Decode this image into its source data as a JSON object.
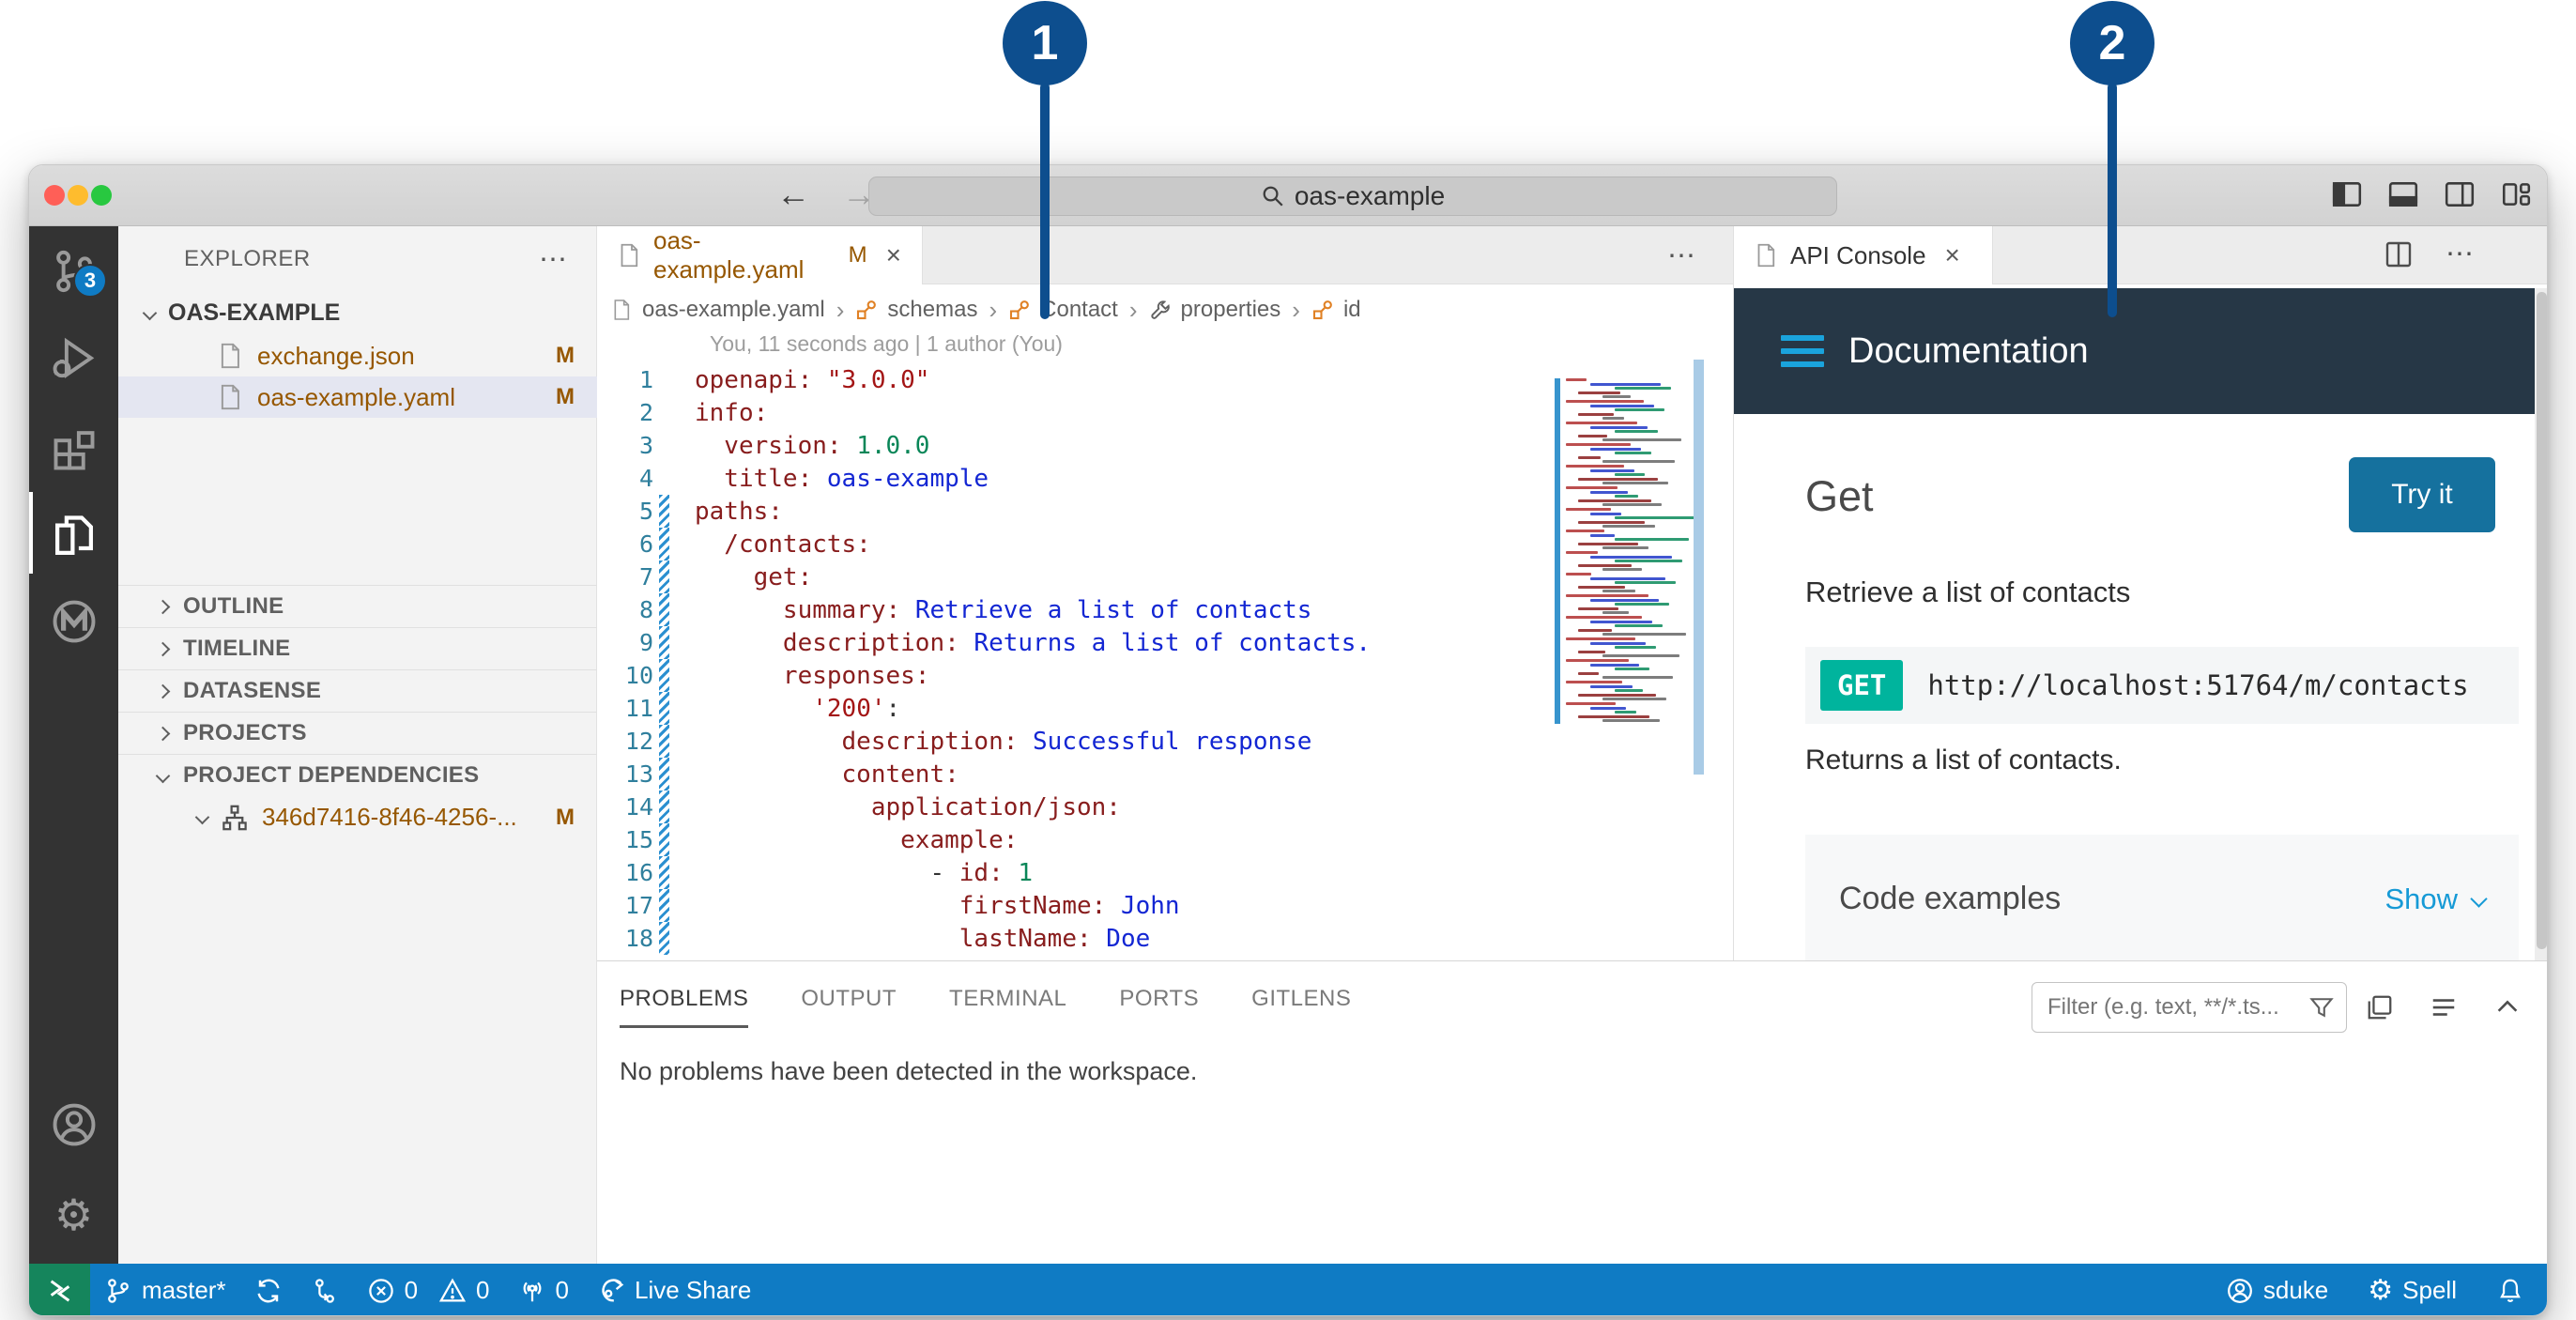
{
  "callouts": {
    "one": "1",
    "two": "2"
  },
  "titlebar": {
    "search_value": "oas-example"
  },
  "activity_bar": {
    "scm_badge": "3"
  },
  "explorer": {
    "title": "EXPLORER",
    "project": "OAS-EXAMPLE",
    "files": [
      {
        "name": "exchange.json",
        "badge": "M",
        "selected": false
      },
      {
        "name": "oas-example.yaml",
        "badge": "M",
        "selected": true
      }
    ],
    "sections": [
      {
        "label": "OUTLINE",
        "expanded": false
      },
      {
        "label": "TIMELINE",
        "expanded": false
      },
      {
        "label": "DATASENSE",
        "expanded": false
      },
      {
        "label": "PROJECTS",
        "expanded": false
      },
      {
        "label": "PROJECT DEPENDENCIES",
        "expanded": true
      }
    ],
    "dependency": {
      "name": "346d7416-8f46-4256-...",
      "badge": "M"
    }
  },
  "editor": {
    "tab": {
      "title": "oas-example.yaml",
      "badge": "M",
      "close": "×"
    },
    "breadcrumb": [
      {
        "label": "oas-example.yaml",
        "icon": "file"
      },
      {
        "label": "schemas",
        "icon": "class"
      },
      {
        "label": "Contact",
        "icon": "class"
      },
      {
        "label": "properties",
        "icon": "wrench"
      },
      {
        "label": "id",
        "icon": "class"
      }
    ],
    "blame": "You, 11 seconds ago | 1 author (You)",
    "lines": [
      {
        "n": "1",
        "mod": false,
        "t": [
          [
            "openapi: ",
            "k"
          ],
          [
            "\"3.0.0\"",
            "s"
          ]
        ]
      },
      {
        "n": "2",
        "mod": false,
        "t": [
          [
            "info:",
            "k"
          ]
        ]
      },
      {
        "n": "3",
        "mod": false,
        "t": [
          [
            "  version: ",
            "k"
          ],
          [
            "1.0.0",
            "n"
          ]
        ]
      },
      {
        "n": "4",
        "mod": false,
        "t": [
          [
            "  title: ",
            "k"
          ],
          [
            "oas-example",
            "v"
          ]
        ]
      },
      {
        "n": "5",
        "mod": true,
        "t": [
          [
            "paths:",
            "k"
          ]
        ]
      },
      {
        "n": "6",
        "mod": true,
        "t": [
          [
            "  /contacts:",
            "k"
          ]
        ]
      },
      {
        "n": "7",
        "mod": true,
        "t": [
          [
            "    get:",
            "k"
          ]
        ]
      },
      {
        "n": "8",
        "mod": true,
        "t": [
          [
            "      summary: ",
            "k"
          ],
          [
            "Retrieve a list of contacts",
            "v"
          ]
        ]
      },
      {
        "n": "9",
        "mod": true,
        "t": [
          [
            "      description: ",
            "k"
          ],
          [
            "Returns a list of contacts.",
            "v"
          ]
        ]
      },
      {
        "n": "10",
        "mod": true,
        "t": [
          [
            "      responses:",
            "k"
          ]
        ]
      },
      {
        "n": "11",
        "mod": true,
        "t": [
          [
            "        ",
            "d"
          ],
          [
            "'200'",
            "s"
          ],
          [
            ":",
            "d"
          ]
        ]
      },
      {
        "n": "12",
        "mod": true,
        "t": [
          [
            "          description: ",
            "k"
          ],
          [
            "Successful response",
            "v"
          ]
        ]
      },
      {
        "n": "13",
        "mod": true,
        "t": [
          [
            "          content:",
            "k"
          ]
        ]
      },
      {
        "n": "14",
        "mod": true,
        "t": [
          [
            "            application/json:",
            "k"
          ]
        ]
      },
      {
        "n": "15",
        "mod": true,
        "t": [
          [
            "              example:",
            "k"
          ]
        ]
      },
      {
        "n": "16",
        "mod": true,
        "t": [
          [
            "                - ",
            "d"
          ],
          [
            "id: ",
            "k"
          ],
          [
            "1",
            "n"
          ]
        ]
      },
      {
        "n": "17",
        "mod": true,
        "t": [
          [
            "                  firstName: ",
            "k"
          ],
          [
            "John",
            "v"
          ]
        ]
      },
      {
        "n": "18",
        "mod": true,
        "t": [
          [
            "                  lastName: ",
            "k"
          ],
          [
            "Doe",
            "v"
          ]
        ]
      }
    ],
    "minimap_palette": [
      "#b03030",
      "#2038c8",
      "#0a8a5a",
      "#8a1f1f",
      "#666666"
    ]
  },
  "api_console": {
    "tab": {
      "title": "API Console",
      "close": "×"
    },
    "header_title": "Documentation",
    "method_heading": "Get",
    "try_it_label": "Try it",
    "summary": "Retrieve a list of contacts",
    "method_badge": "GET",
    "url": "http://localhost:51764/m/contacts",
    "description": "Returns a list of contacts.",
    "code_examples_label": "Code examples",
    "show_label": "Show"
  },
  "bottom_panel": {
    "tabs": [
      "PROBLEMS",
      "OUTPUT",
      "TERMINAL",
      "PORTS",
      "GITLENS"
    ],
    "active_tab": "PROBLEMS",
    "message": "No problems have been detected in the workspace.",
    "filter_placeholder": "Filter (e.g. text, **/*.ts..."
  },
  "status_bar": {
    "branch": "master*",
    "errors": "0",
    "warnings": "0",
    "ports": "0",
    "live_share": "Live Share",
    "user": "sduke",
    "spell": "Spell"
  },
  "colors": {
    "callout_blue": "#0d4e8e",
    "status_blue": "#0f7bc4",
    "status_green": "#15855c",
    "navy": "#263746",
    "cyan": "#1aa3dc",
    "tryit": "#15719e",
    "get_badge": "#00b49d",
    "show_link": "#169ad6",
    "modified": "#965700",
    "selection": "#e4e6f1"
  }
}
